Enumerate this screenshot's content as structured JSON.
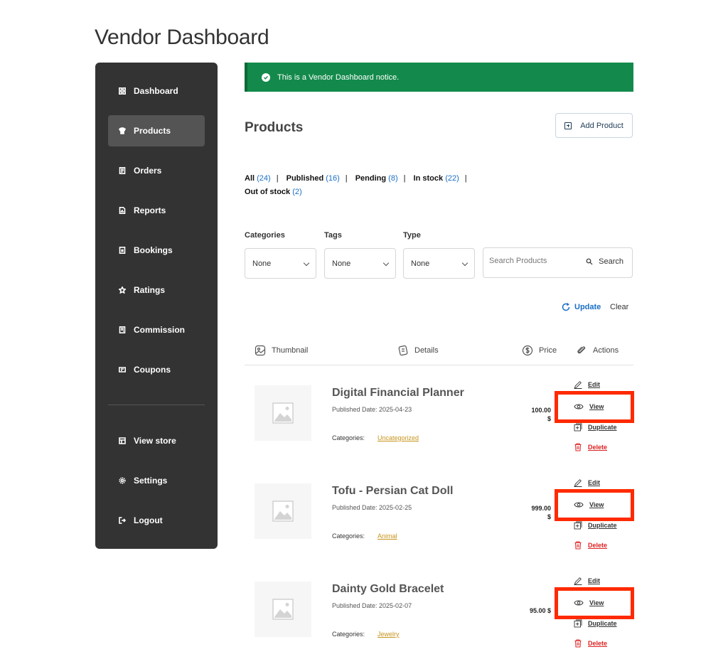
{
  "page": {
    "title": "Vendor Dashboard"
  },
  "sidebar": {
    "items": [
      {
        "label": "Dashboard",
        "icon": "grid-icon"
      },
      {
        "label": "Products",
        "icon": "shirt-icon",
        "active": true
      },
      {
        "label": "Orders",
        "icon": "receipt-icon"
      },
      {
        "label": "Reports",
        "icon": "report-icon"
      },
      {
        "label": "Bookings",
        "icon": "booking-icon"
      },
      {
        "label": "Ratings",
        "icon": "star-icon"
      },
      {
        "label": "Commission",
        "icon": "commission-icon"
      },
      {
        "label": "Coupons",
        "icon": "coupon-icon"
      }
    ],
    "bottom_items": [
      {
        "label": "View store",
        "icon": "store-icon"
      },
      {
        "label": "Settings",
        "icon": "gear-icon"
      },
      {
        "label": "Logout",
        "icon": "logout-icon"
      }
    ]
  },
  "notice": {
    "text": "This is a Vendor Dashboard notice.",
    "color": "#138a4b"
  },
  "products": {
    "title": "Products",
    "add_label": "Add Product",
    "status_filters": [
      {
        "label": "All",
        "count": "(24)"
      },
      {
        "label": "Published",
        "count": "(16)"
      },
      {
        "label": "Pending",
        "count": "(8)"
      },
      {
        "label": "In stock",
        "count": "(22)"
      },
      {
        "label": "Out of stock",
        "count": "(2)"
      }
    ],
    "filters": {
      "categories": {
        "label": "Categories",
        "value": "None"
      },
      "tags": {
        "label": "Tags",
        "value": "None"
      },
      "type": {
        "label": "Type",
        "value": "None"
      }
    },
    "search": {
      "placeholder": "Search Products",
      "button": "Search"
    },
    "update_label": "Update",
    "clear_label": "Clear",
    "columns": {
      "thumbnail": "Thumbnail",
      "details": "Details",
      "price": "Price",
      "actions": "Actions"
    },
    "actions": {
      "edit": "Edit",
      "view": "View",
      "duplicate": "Duplicate",
      "delete": "Delete"
    },
    "categories_label": "Categories:",
    "rows": [
      {
        "name": "Digital Financial Planner",
        "date": "Published Date: 2025-04-23",
        "category": "Uncategorized",
        "price": "100.00",
        "currency": "$"
      },
      {
        "name": "Tofu - Persian Cat Doll",
        "date": "Published Date: 2025-02-25",
        "category": "Animal",
        "price": "999.00",
        "currency": "$"
      },
      {
        "name": "Dainty Gold Bracelet",
        "date": "Published Date: 2025-02-07",
        "category": "Jewelry",
        "price": "95.00 $",
        "currency": ""
      }
    ]
  },
  "highlight_color": "#ff2a00"
}
